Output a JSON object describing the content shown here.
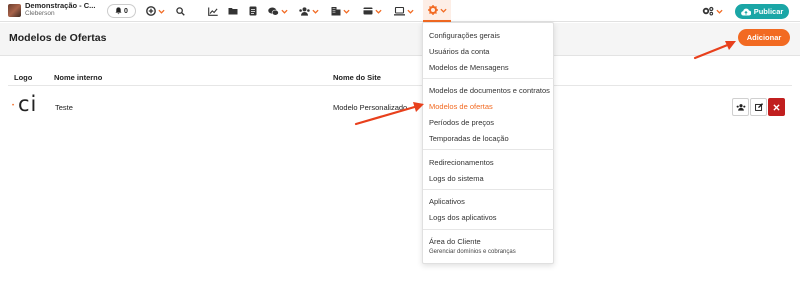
{
  "account": {
    "name": "Demonstração - C...",
    "user": "Cleberson"
  },
  "notifications": {
    "count": "0"
  },
  "toolbar": {
    "icons": [
      "add-icon",
      "search-icon",
      "chart-icon",
      "folder-icon",
      "document-icon",
      "chat-icon",
      "users-icon",
      "building-icon",
      "card-icon",
      "laptop-icon",
      "gear-icon"
    ],
    "publish_label": "Publicar",
    "accent": "#f26a22",
    "publish_color": "#1aa6a6"
  },
  "page": {
    "title": "Modelos de Ofertas",
    "add_label": "Adicionar"
  },
  "table": {
    "columns": [
      "Logo",
      "Nome interno",
      "Nome do Site"
    ],
    "rows": [
      {
        "logo_text": "ci",
        "internal_name": "Teste",
        "site_name": "Modelo Personalizado"
      }
    ]
  },
  "menu": {
    "items": [
      {
        "label": "Configurações gerais"
      },
      {
        "label": "Usuários da conta"
      },
      {
        "label": "Modelos de Mensagens"
      },
      {
        "label": "Modelos de documentos e contratos"
      },
      {
        "label": "Modelos de ofertas",
        "active": true
      },
      {
        "label": "Períodos de preços"
      },
      {
        "label": "Temporadas de locação"
      },
      {
        "label": "Redirecionamentos"
      },
      {
        "label": "Logs do sistema"
      },
      {
        "label": "Aplicativos"
      },
      {
        "label": "Logs dos aplicativos"
      },
      {
        "label": "Área do Cliente",
        "sublabel": "Gerenciar domínios e cobranças"
      }
    ]
  }
}
